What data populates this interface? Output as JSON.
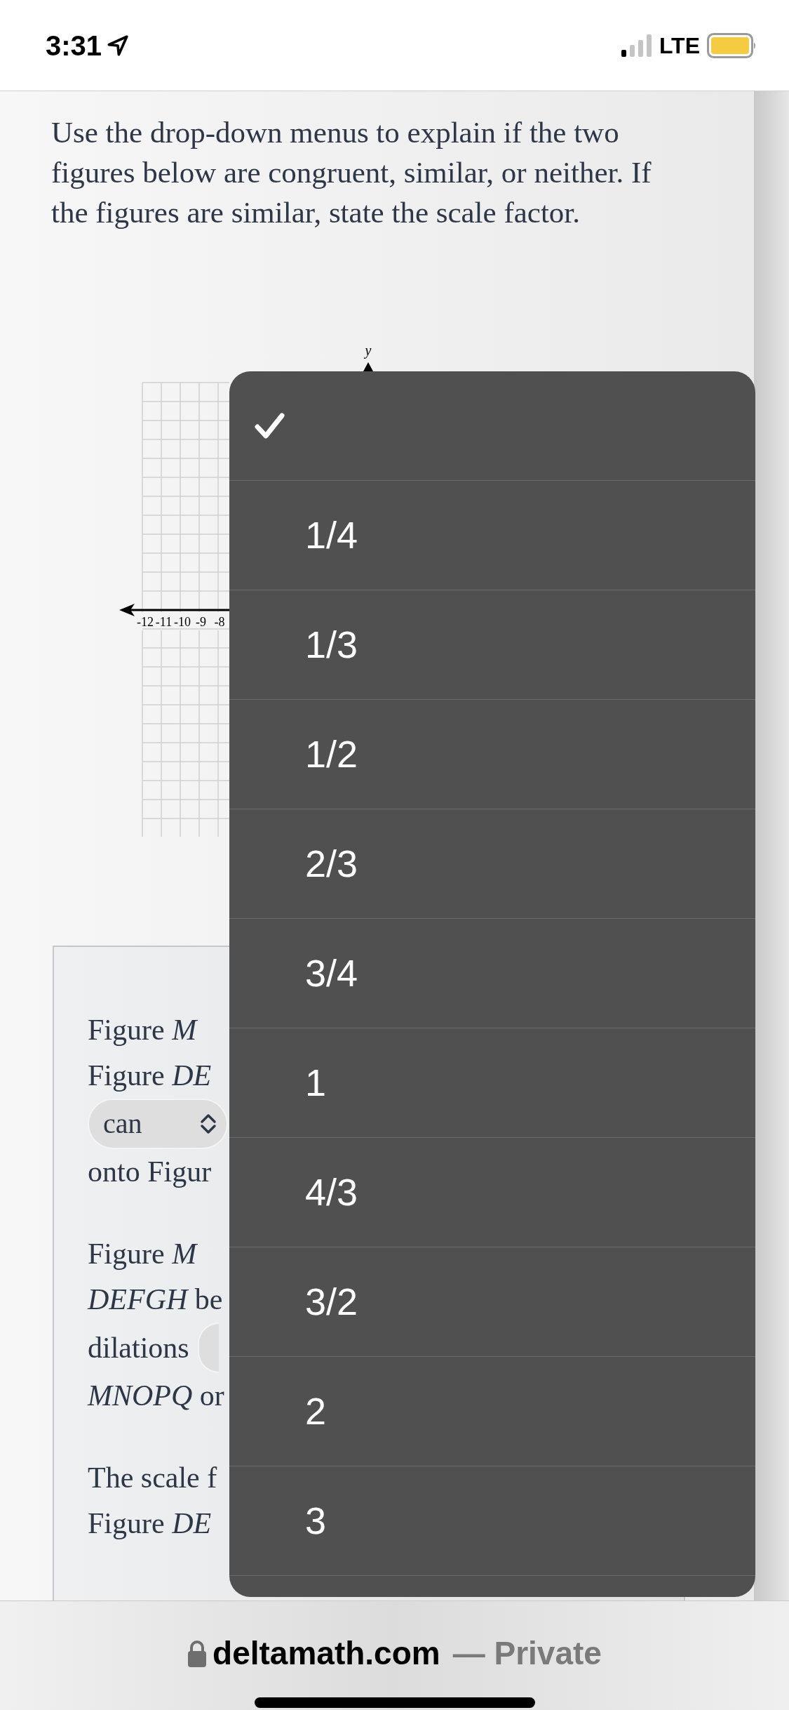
{
  "status_bar": {
    "time": "3:31",
    "network": "LTE"
  },
  "instructions": "Use the drop-down menus to explain if the two figures below are congruent, similar, or neither. If the figures are similar, state the scale factor.",
  "graph": {
    "axis_label": "y",
    "x_tick_labels": [
      "-12",
      "-11",
      "-10",
      "-9",
      "-8"
    ]
  },
  "answer_paragraphs": [
    [
      [
        {
          "kind": "text",
          "text": "Figure *M*"
        }
      ],
      [
        {
          "kind": "text",
          "text": "Figure *DE*"
        }
      ],
      [
        {
          "kind": "select",
          "value": "can"
        }
      ],
      [
        {
          "kind": "text",
          "text": "onto Figur"
        }
      ]
    ],
    [
      [
        {
          "kind": "text",
          "text": "Figure *M*"
        }
      ],
      [
        {
          "kind": "text",
          "text": "*DEFGH* be"
        }
      ],
      [
        {
          "kind": "text",
          "text": "dilations"
        },
        {
          "kind": "select"
        }
      ],
      [
        {
          "kind": "text",
          "text": "*MNOPQ* or"
        }
      ]
    ],
    [
      [
        {
          "kind": "text",
          "text": "The scale f"
        }
      ],
      [
        {
          "kind": "text",
          "text": "Figure *DE*"
        }
      ]
    ]
  ],
  "dropdown": {
    "options": [
      {
        "selected": true
      },
      {
        "label": "1/4",
        "selected": false
      },
      {
        "label": "1/3",
        "selected": false
      },
      {
        "label": "1/2",
        "selected": false
      },
      {
        "label": "2/3",
        "selected": false
      },
      {
        "label": "3/4",
        "selected": false
      },
      {
        "label": "1",
        "selected": false
      },
      {
        "label": "4/3",
        "selected": false
      },
      {
        "label": "3/2",
        "selected": false
      },
      {
        "label": "2",
        "selected": false
      },
      {
        "label": "3",
        "selected": false
      }
    ]
  },
  "browser_bar": {
    "domain": "deltamath.com",
    "suffix": "— Private"
  }
}
